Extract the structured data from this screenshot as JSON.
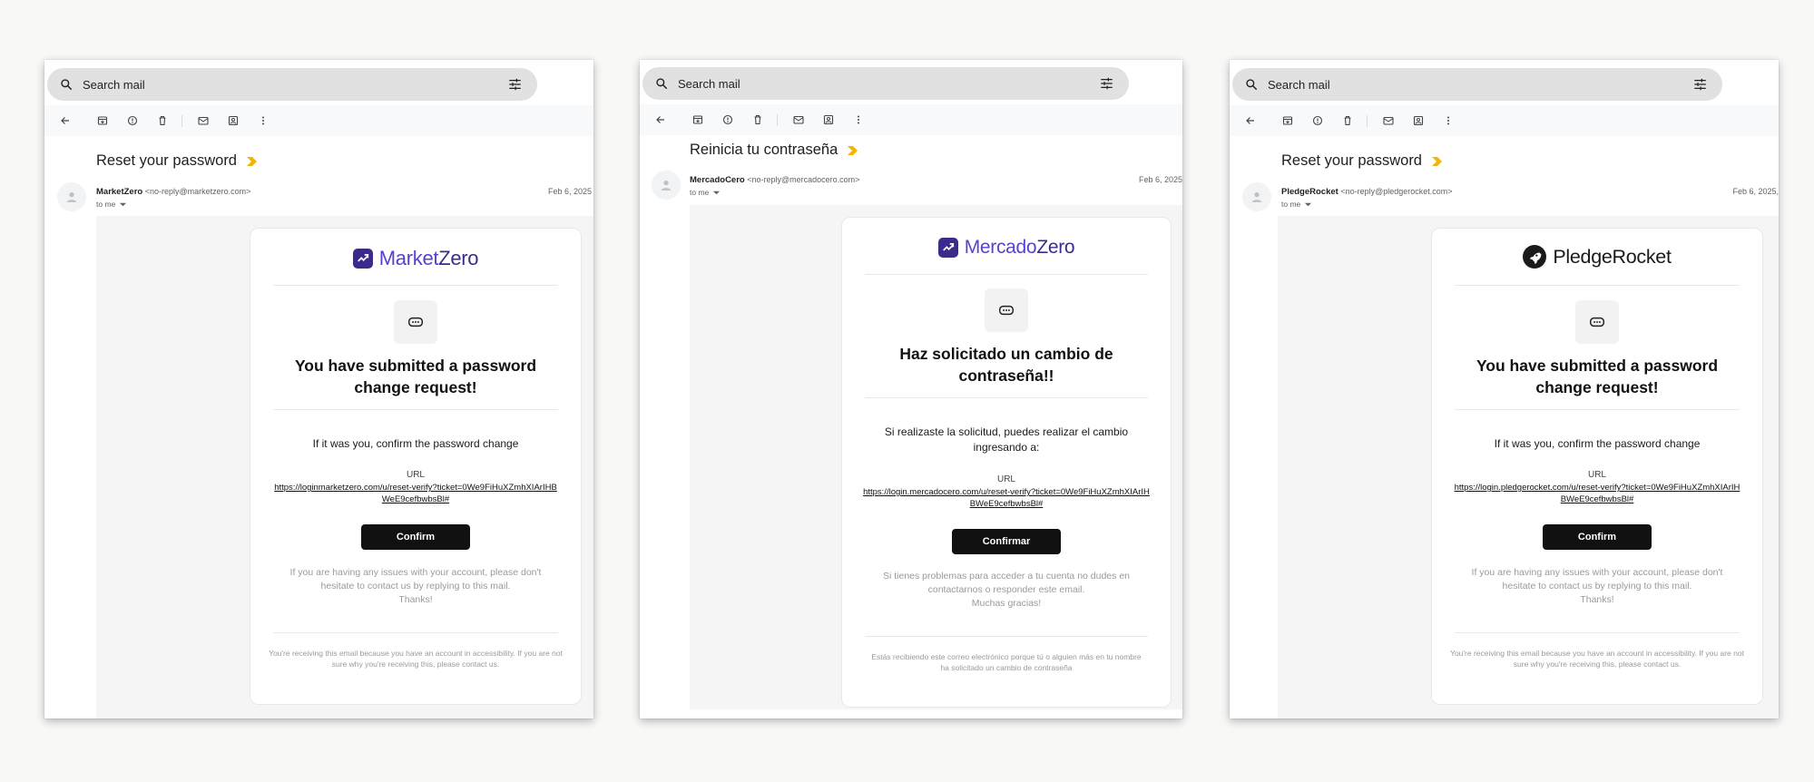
{
  "colors": {
    "brand_purple": "#5b3fd0",
    "button": "#111111",
    "search_bg": "#e1e1e1",
    "body_bg": "#f5f5f5",
    "important_marker": "#f4b400"
  },
  "panels": [
    {
      "search": {
        "placeholder": "Search mail",
        "search_icon": "search-icon",
        "filter_icon": "tune-icon"
      },
      "subject": "Reset your password",
      "sender_name": "MarketZero",
      "sender_email": "<no-reply@marketzero.com>",
      "to": "to me",
      "date": "Feb 6, 2025",
      "logo": {
        "name_a": "Market",
        "name_b": "Zero",
        "icon": "chart-up-icon"
      },
      "heading": "You have submitted a password change request!",
      "instruction": "If it was you, confirm the password change",
      "url_label": "URL",
      "url": "https://loginmarketzero.com/u/reset-verify?ticket=0We9FiHuXZmhXIArIHBWeE9cefbwbsBl#",
      "button": "Confirm",
      "help": "If you are having any issues with your account, please don't hesitate to contact us by replying to this mail.",
      "thanks": "Thanks!",
      "footer": "You're receiving this email because you have an account in accessibility. If you are not sure why you're receiving this, please contact us."
    },
    {
      "search": {
        "placeholder": "Search mail",
        "search_icon": "search-icon",
        "filter_icon": "tune-icon"
      },
      "subject": "Reinicia tu contraseña",
      "sender_name": "MercadoCero",
      "sender_email": "<no-reply@mercadocero.com>",
      "to": "to me",
      "date": "Feb 6, 2025",
      "logo": {
        "name_a": "Mercado",
        "name_b": "Zero",
        "icon": "chart-up-icon"
      },
      "heading": "Haz solicitado un cambio de contraseña!!",
      "instruction": "Si realizaste la solicitud, puedes realizar el cambio ingresando a:",
      "url_label": "URL",
      "url": "https://login.mercadocero.com/u/reset-verify?ticket=0We9FiHuXZmhXIArIHBWeE9cefbwbsBl#",
      "button": "Confirmar",
      "help": "Si tienes problemas para acceder a tu cuenta no dudes en contactarnos o responder este email.",
      "thanks": "Muchas gracias!",
      "footer": "Estás recibiendo este correo electrónico porque tú o alguien más en tu nombre ha solicitado un cambio de contraseña"
    },
    {
      "search": {
        "placeholder": "Search mail",
        "search_icon": "search-icon",
        "filter_icon": "tune-icon"
      },
      "subject": "Reset your password",
      "sender_name": "PledgeRocket",
      "sender_email": "<no-reply@pledgerocket.com>",
      "to": "to me",
      "date": "Feb 6, 2025,",
      "logo": {
        "name_a": "PledgeRocket",
        "name_b": "",
        "icon": "rocket-icon"
      },
      "heading": "You have submitted a password change request!",
      "instruction": "If it was you, confirm the password change",
      "url_label": "URL",
      "url": "https://login.pledgerocket.com/u/reset-verify?ticket=0We9FiHuXZmhXIArIHBWeE9cefbwbsBl#",
      "button": "Confirm",
      "help": "If you are having any issues with your account, please don't hesitate to contact us by replying to this mail.",
      "thanks": "Thanks!",
      "footer": "You're receiving this email because you have an account in accessibility. If you are not sure why you're receiving this, please contact us."
    }
  ]
}
